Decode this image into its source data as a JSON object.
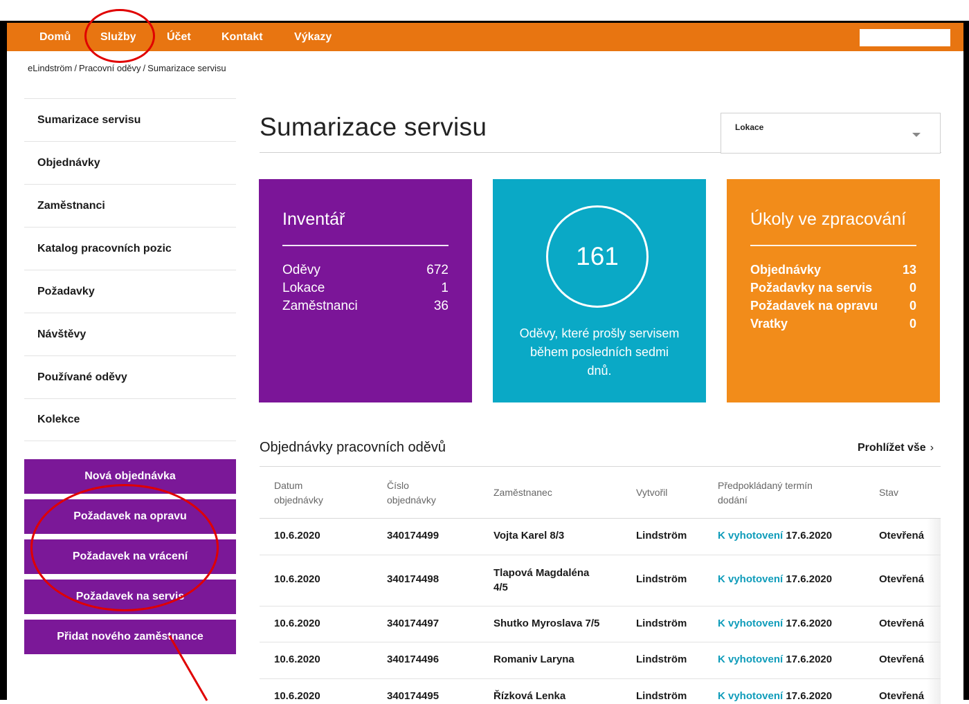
{
  "nav": {
    "items": [
      "Domů",
      "Služby",
      "Účet",
      "Kontakt",
      "Výkazy"
    ]
  },
  "breadcrumb": [
    "eLindström",
    "/",
    "Pracovní oděvy",
    "/",
    "Sumarizace servisu"
  ],
  "sidebar": {
    "items": [
      "Sumarizace servisu",
      "Objednávky",
      "Zaměstnanci",
      "Katalog pracovních pozic",
      "Požadavky",
      "Návštěvy",
      "Používané oděvy",
      "Kolekce"
    ],
    "buttons": [
      "Nová objednávka",
      "Požadavek na opravu",
      "Požadavek na vrácení",
      "Požadavek na servis",
      "Přidat nového zaměstnance"
    ]
  },
  "page": {
    "title": "Sumarizace servisu",
    "location_label": "Lokace"
  },
  "cards": {
    "inventory": {
      "title": "Inventář",
      "rows": [
        {
          "label": "Oděvy",
          "value": "672"
        },
        {
          "label": "Lokace",
          "value": "1"
        },
        {
          "label": "Zaměstnanci",
          "value": "36"
        }
      ]
    },
    "serviced": {
      "value": "161",
      "caption_lines": [
        "Oděvy, které prošly servisem",
        "během posledních sedmi",
        "dnů."
      ]
    },
    "tasks": {
      "title": "Úkoly ve zpracování",
      "rows": [
        {
          "label": "Objednávky",
          "value": "13"
        },
        {
          "label": "Požadavky na servis",
          "value": "0"
        },
        {
          "label": "Požadavek na opravu",
          "value": "0"
        },
        {
          "label": "Vratky",
          "value": "0"
        }
      ]
    }
  },
  "orders": {
    "title": "Objednávky pracovních oděvů",
    "browse_label": "Prohlížet vše",
    "browse_chevron": "›",
    "headers": {
      "date": [
        "Datum",
        "objednávky"
      ],
      "number": [
        "Číslo",
        "objednávky"
      ],
      "employee": "Zaměstnanec",
      "created_by": "Vytvořil",
      "delivery": [
        "Předpokládaný termín",
        "dodání"
      ],
      "status": "Stav"
    },
    "rows": [
      {
        "date": "10.6.2020",
        "number": "340174499",
        "employee": "Vojta Karel 8/3",
        "employee2": "",
        "created_by": "Lindström",
        "delivery_link": "K vyhotovení",
        "delivery_date": "17.6.2020",
        "status": "Otevřená"
      },
      {
        "date": "10.6.2020",
        "number": "340174498",
        "employee": "Tlapová Magdaléna",
        "employee2": "4/5",
        "created_by": "Lindström",
        "delivery_link": "K vyhotovení",
        "delivery_date": "17.6.2020",
        "status": "Otevřená"
      },
      {
        "date": "10.6.2020",
        "number": "340174497",
        "employee": "Shutko Myroslava 7/5",
        "employee2": "",
        "created_by": "Lindström",
        "delivery_link": "K vyhotovení",
        "delivery_date": "17.6.2020",
        "status": "Otevřená"
      },
      {
        "date": "10.6.2020",
        "number": "340174496",
        "employee": "Romaniv Laryna",
        "employee2": "",
        "created_by": "Lindström",
        "delivery_link": "K vyhotovení",
        "delivery_date": "17.6.2020",
        "status": "Otevřená"
      },
      {
        "date": "10.6.2020",
        "number": "340174495",
        "employee": "Řízková Lenka",
        "employee2": "",
        "created_by": "Lindström",
        "delivery_link": "K vyhotovení",
        "delivery_date": "17.6.2020",
        "status": "Otevřená"
      }
    ]
  },
  "colors": {
    "nav": "#e87511",
    "purple": "#7b1598",
    "teal": "#0aa9c6",
    "orange": "#f28c1a",
    "link": "#0f9cba",
    "annotation": "#e00000"
  }
}
